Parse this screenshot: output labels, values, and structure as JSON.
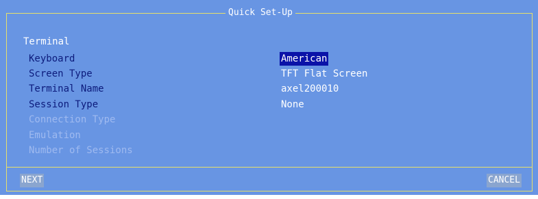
{
  "dialog": {
    "title": "Quick Set-Up",
    "section": "Terminal",
    "fields": [
      {
        "label": "Keyboard",
        "value": "American",
        "state": "active"
      },
      {
        "label": "Screen Type",
        "value": "TFT Flat Screen",
        "state": "active"
      },
      {
        "label": "Terminal Name",
        "value": "axel200010",
        "state": "active"
      },
      {
        "label": "Session Type",
        "value": "None",
        "state": "active"
      },
      {
        "label": "Connection Type",
        "value": "",
        "state": "disabled"
      },
      {
        "label": "Emulation",
        "value": "",
        "state": "disabled"
      },
      {
        "label": "Number of Sessions",
        "value": "",
        "state": "disabled"
      }
    ],
    "buttons": {
      "next": "NEXT",
      "cancel": "CANCEL"
    }
  },
  "colors": {
    "background": "#6895e3",
    "border": "#e8e06a",
    "active_label": "#0c1b7c",
    "disabled_label": "#9fbaf0",
    "selection": "#0a12a8"
  }
}
